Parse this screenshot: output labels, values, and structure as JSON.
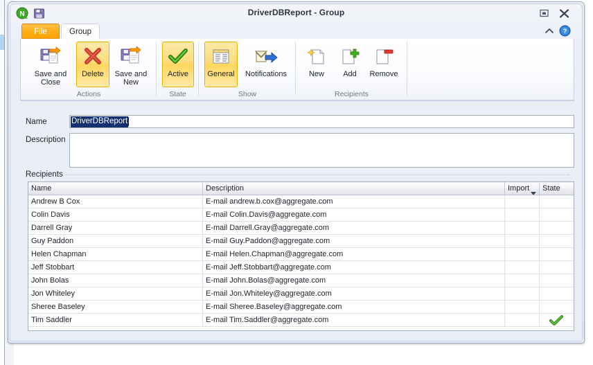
{
  "window": {
    "title": "DriverDBReport - Group",
    "logo_icon": "nimbus-green-n-logo-icon",
    "quick_access": {
      "save_icon": "save-floppy-icon"
    },
    "controls": {
      "restore": "restore-window-icon",
      "close": "close-window-icon"
    }
  },
  "tabs": [
    {
      "id": "file",
      "label": "File",
      "active": false
    },
    {
      "id": "group",
      "label": "Group",
      "active": true
    }
  ],
  "tab_row": {
    "collapse_ribbon_icon": "chevron-up-icon",
    "help_icon": "help-question-icon"
  },
  "ribbon": {
    "groups": [
      {
        "name": "actions",
        "label": "Actions",
        "buttons": [
          {
            "id": "save-and-close",
            "label": "Save and Close",
            "icon": "save-and-close-icon",
            "selected": false
          },
          {
            "id": "delete",
            "label": "Delete",
            "icon": "delete-x-icon",
            "selected": true
          },
          {
            "id": "save-and-new",
            "label": "Save and New",
            "icon": "save-and-new-icon",
            "selected": false
          }
        ]
      },
      {
        "name": "state",
        "label": "State",
        "buttons": [
          {
            "id": "active",
            "label": "Active",
            "icon": "green-check-icon",
            "selected": true
          }
        ]
      },
      {
        "name": "show",
        "label": "Show",
        "buttons": [
          {
            "id": "general",
            "label": "General",
            "icon": "general-form-icon",
            "selected": true
          },
          {
            "id": "notifications",
            "label": "Notifications",
            "icon": "envelope-arrow-icon",
            "selected": false
          }
        ]
      },
      {
        "name": "recipients",
        "label": "Recipients",
        "buttons": [
          {
            "id": "new",
            "label": "New",
            "icon": "new-document-icon",
            "selected": false
          },
          {
            "id": "add",
            "label": "Add",
            "icon": "add-plus-document-icon",
            "selected": false
          },
          {
            "id": "remove",
            "label": "Remove",
            "icon": "remove-minus-document-icon",
            "selected": false
          }
        ]
      }
    ]
  },
  "form": {
    "name": {
      "label": "Name",
      "value": "DriverDBReport",
      "selected": true
    },
    "description": {
      "label": "Description",
      "value": "",
      "placeholder": ""
    },
    "recipients_section_label": "Recipients"
  },
  "grid": {
    "columns": [
      {
        "key": "name",
        "label": "Name",
        "sortable": false
      },
      {
        "key": "description",
        "label": "Description",
        "sortable": false
      },
      {
        "key": "important",
        "label": "Import",
        "sortable": true,
        "sort_icon": "chevron-down-icon"
      },
      {
        "key": "state",
        "label": "State",
        "sortable": false
      }
    ],
    "rows": [
      {
        "name": "Andrew B Cox",
        "description": "E-mail andrew.b.cox@aggregate.com",
        "important": "",
        "state": ""
      },
      {
        "name": "Colin Davis",
        "description": "E-mail Colin.Davis@aggregate.com",
        "important": "",
        "state": ""
      },
      {
        "name": "Darrell Gray",
        "description": "E-mail Darrell.Gray@aggregate.com",
        "important": "",
        "state": ""
      },
      {
        "name": "Guy Paddon",
        "description": "E-mail Guy.Paddon@aggregate.com",
        "important": "",
        "state": ""
      },
      {
        "name": "Helen Chapman",
        "description": "E-mail Helen.Chapman@aggregate.com",
        "important": "",
        "state": ""
      },
      {
        "name": "Jeff Stobbart",
        "description": "E-mail Jeff.Stobbart@aggregate.com",
        "important": "",
        "state": ""
      },
      {
        "name": "John Bolas",
        "description": "E-mail John.Bolas@aggregate.com",
        "important": "",
        "state": ""
      },
      {
        "name": "Jon Whiteley",
        "description": "E-mail Jon.Whiteley@aggregate.com",
        "important": "",
        "state": ""
      },
      {
        "name": "Sheree Baseley",
        "description": "E-mail Sheree.Baseley@aggregate.com",
        "important": "",
        "state": ""
      },
      {
        "name": "Tim Saddler",
        "description": "E-mail Tim.Saddler@aggregate.com",
        "important": "",
        "state": "check"
      }
    ]
  },
  "colors": {
    "file_tab_orange": "#ffae18",
    "selected_button_yellow": "#ffd65e",
    "selection_blue": "#12306e",
    "check_green": "#4aa523",
    "delete_red": "#c0392b",
    "window_border": "#9facc4"
  }
}
